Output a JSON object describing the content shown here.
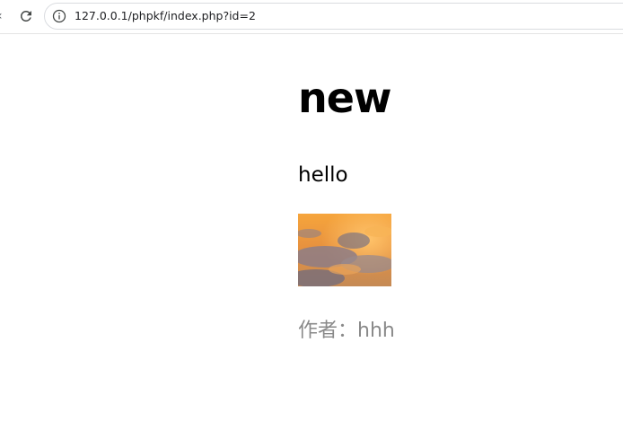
{
  "browser": {
    "url": "127.0.0.1/phpkf/index.php?id=2",
    "icons": {
      "back": "back-arrow-icon",
      "reload": "reload-icon",
      "site_info": "info-icon"
    }
  },
  "article": {
    "title": "new",
    "body": "hello",
    "image": {
      "description": "sunset-cloud-thumbnail",
      "colors": [
        "#f4a23c",
        "#8a7e8c",
        "#c98a4e",
        "#6f6876"
      ]
    },
    "author_label": "作者：",
    "author_name": "hhh"
  }
}
